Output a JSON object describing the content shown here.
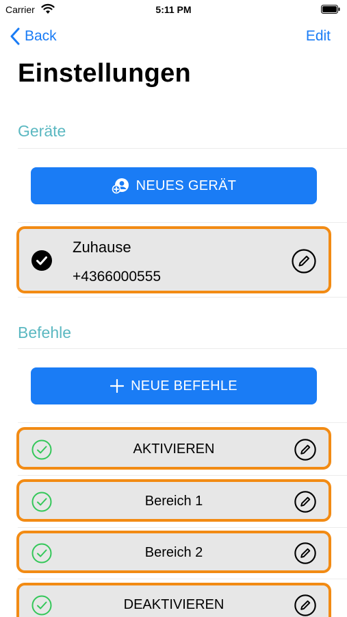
{
  "status_bar": {
    "carrier": "Carrier",
    "time": "5:11 PM"
  },
  "nav": {
    "back_label": "Back",
    "edit_label": "Edit"
  },
  "title": "Einstellungen",
  "devices_section": {
    "header": "Geräte",
    "add_button_label": "NEUES GERÄT",
    "items": [
      {
        "name": "Zuhause",
        "phone": "+4366000555",
        "selected": true
      }
    ]
  },
  "commands_section": {
    "header": "Befehle",
    "add_button_label": "NEUE BEFEHLE",
    "items": [
      {
        "label": "AKTIVIEREN"
      },
      {
        "label": "Bereich 1"
      },
      {
        "label": "Bereich 2"
      },
      {
        "label": "DEAKTIVIEREN"
      }
    ]
  },
  "colors": {
    "accent": "#1a7cf5",
    "section_header": "#5bb8c1",
    "card_border": "#f28b14",
    "card_bg": "#e7e7e7",
    "check_green": "#34c759"
  },
  "icons": [
    "wifi-icon",
    "battery-icon",
    "chevron-left-icon",
    "add-device-icon",
    "checkmark-filled-icon",
    "pencil-circle-icon",
    "plus-icon",
    "checkmark-circle-icon"
  ]
}
